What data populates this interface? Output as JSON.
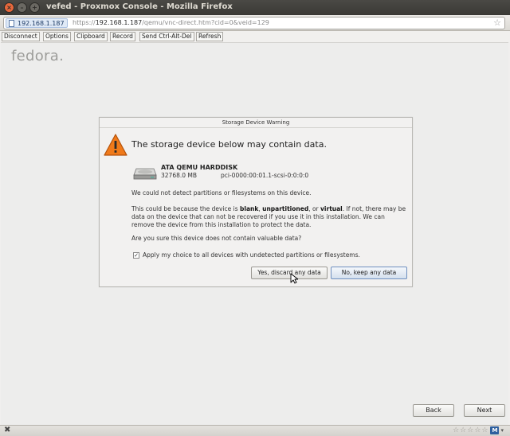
{
  "window": {
    "title": "vefed - Proxmox Console - Mozilla Firefox"
  },
  "urlbar": {
    "identity": "192.168.1.187",
    "scheme": "https://",
    "host": "192.168.1.187",
    "path": "/qemu/vnc-direct.htm?cid=0&veid=129"
  },
  "novnc": {
    "buttons": [
      "Disconnect",
      "Options",
      "Clipboard",
      "Record",
      "Send Ctrl-Alt-Del",
      "Refresh"
    ]
  },
  "installer": {
    "logo": "fedora.",
    "dialog": {
      "title": "Storage Device Warning",
      "headline": "The storage device below may contain data.",
      "device": {
        "name": "ATA QEMU HARDDISK",
        "size": "32768.0 MB",
        "path": "pci-0000:00:01.1-scsi-0:0:0:0"
      },
      "para1": "We could not detect partitions or filesystems on this device.",
      "para2_a": "This could be because the device is ",
      "para2_blank": "blank",
      "para2_b": ", ",
      "para2_unpart": "unpartitioned",
      "para2_c": ", or ",
      "para2_virtual": "virtual",
      "para2_d": ". If not, there may be data on the device that can not be recovered if you use it in this installation. We can remove the device from this installation to protect the data.",
      "para3": "Are you sure this device does not contain valuable data?",
      "checkbox_label": "Apply my choice to all devices with undetected partitions or filesystems.",
      "checkbox_checked": true,
      "discard_label": "Yes, discard any data",
      "keep_label": "No, keep any data"
    },
    "back_label": "Back",
    "next_label": "Next"
  },
  "statusbar": {
    "badge": "M"
  }
}
